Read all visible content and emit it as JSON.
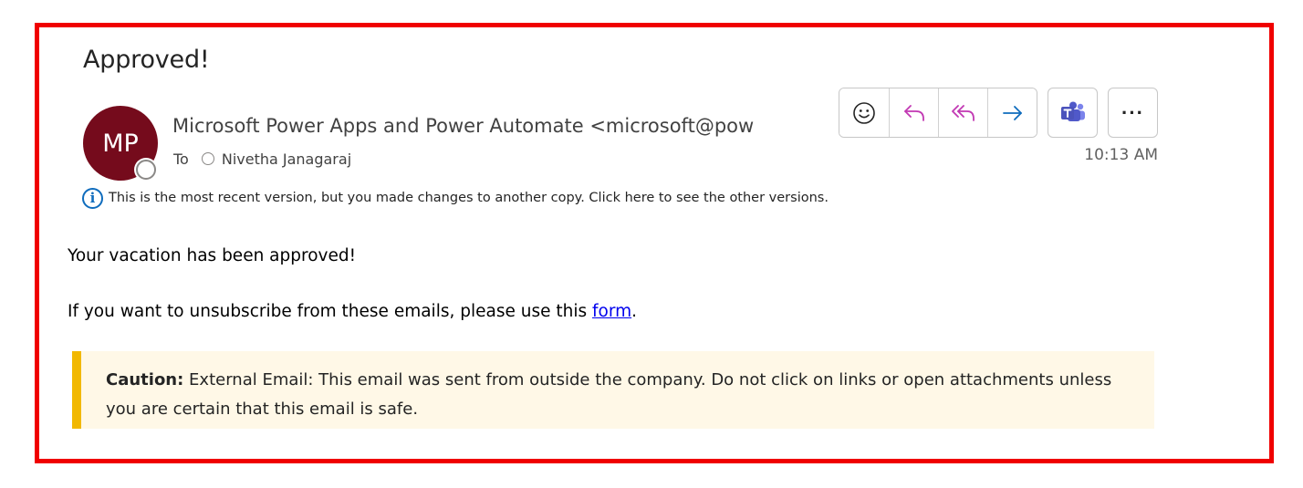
{
  "email": {
    "subject": "Approved!",
    "sender": {
      "initials": "MP",
      "display": "Microsoft Power Apps and Power Automate <microsoft@pow",
      "avatar_color": "#750b1c"
    },
    "to_label": "To",
    "recipient": "Nivetha Janagaraj",
    "info_banner": "This is the most recent version, but you made changes to another copy. Click here to see the other versions.",
    "time": "10:13 AM",
    "body": {
      "line1": "Your vacation has been approved!",
      "line2_prefix": "If you want to unsubscribe from these emails, please use this ",
      "link_text": "form",
      "line2_suffix": "."
    },
    "caution": {
      "label": "Caution:",
      "text": " External Email: This email was sent from outside the company. Do not click on links or open attachments unless you are certain that this email is safe."
    }
  },
  "toolbar": {
    "actions": [
      {
        "name": "emoji-icon"
      },
      {
        "name": "reply-icon"
      },
      {
        "name": "reply-all-icon"
      },
      {
        "name": "forward-icon"
      }
    ],
    "teams": {
      "name": "teams-icon"
    },
    "more": {
      "name": "more-options-icon",
      "glyph": "···"
    }
  },
  "colors": {
    "frame_border": "#f00000",
    "accent": "#c239b3",
    "forward": "#0f6cbd",
    "caution_bar": "#f2b800",
    "caution_bg": "#fff8e7"
  }
}
